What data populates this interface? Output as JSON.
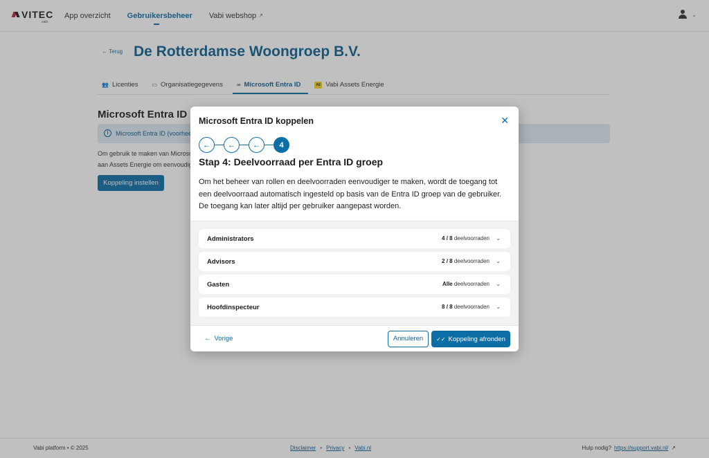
{
  "header": {
    "logo_text": "VITEC",
    "logo_sub": "vabi",
    "nav": [
      {
        "label": "App overzicht"
      },
      {
        "label": "Gebruikersbeheer"
      },
      {
        "label": "Vabi webshop"
      }
    ]
  },
  "page": {
    "back_label": "← Terug",
    "title": "De Rotterdamse Woongroep B.V.",
    "tabs": [
      {
        "label": "Licenties"
      },
      {
        "label": "Organisatiegegevens"
      },
      {
        "label": "Microsoft Entra ID"
      },
      {
        "label": "Vabi Assets Energie",
        "badge": "AE"
      }
    ],
    "section_title": "Microsoft Entra ID koppelen",
    "info_text": "Microsoft Entra ID (voorheen Azure Active Directory)",
    "body_line1": "Om gebruik te maken van Microsoft Entra ID, moet de koppeling eerst worden ingesteld. Klik op de onderstaande knop om te koppelen",
    "body_line2": "aan Assets Energie om eenvoudig in te loggen met uw Microsoft account.",
    "setup_button": "Koppeling instellen"
  },
  "modal": {
    "title": "Microsoft Entra ID koppelen",
    "steps": [
      "←",
      "←",
      "←",
      "4"
    ],
    "heading": "Stap 4: Deelvoorraad per Entra ID groep",
    "description": "Om het beheer van rollen en deelvoorraden eenvoudiger te maken, wordt de toegang tot een deelvoorraad automatisch ingesteld op basis van de Entra ID groep van de gebruiker. De toegang kan later altijd per gebruiker aangepast worden.",
    "groups": [
      {
        "name": "Administrators",
        "count": "4 / 8",
        "suffix": "deelvoorraden"
      },
      {
        "name": "Advisors",
        "count": "2 / 8",
        "suffix": "deelvoorraden"
      },
      {
        "name": "Gasten",
        "count": "Alle",
        "suffix": "deelvoorraden"
      },
      {
        "name": "Hoofdinspecteur",
        "count": "8 / 8",
        "suffix": "deelvoorraden"
      }
    ],
    "prev_label": "Vorige",
    "cancel_label": "Annuleren",
    "finish_label": "Koppeling afronden"
  },
  "footer": {
    "copyright": "Vabi platform • © 2025",
    "links": [
      "Disclaimer",
      "Privacy",
      "Vabi.nl"
    ],
    "help_label": "Hulp nodig?",
    "help_link": "https://support.vabi.nl/"
  },
  "colors": {
    "primary": "#0d6ea6",
    "title_blue": "#0d5f91",
    "info_bg": "#dde9f5",
    "badge_yellow": "#f3d21a"
  }
}
